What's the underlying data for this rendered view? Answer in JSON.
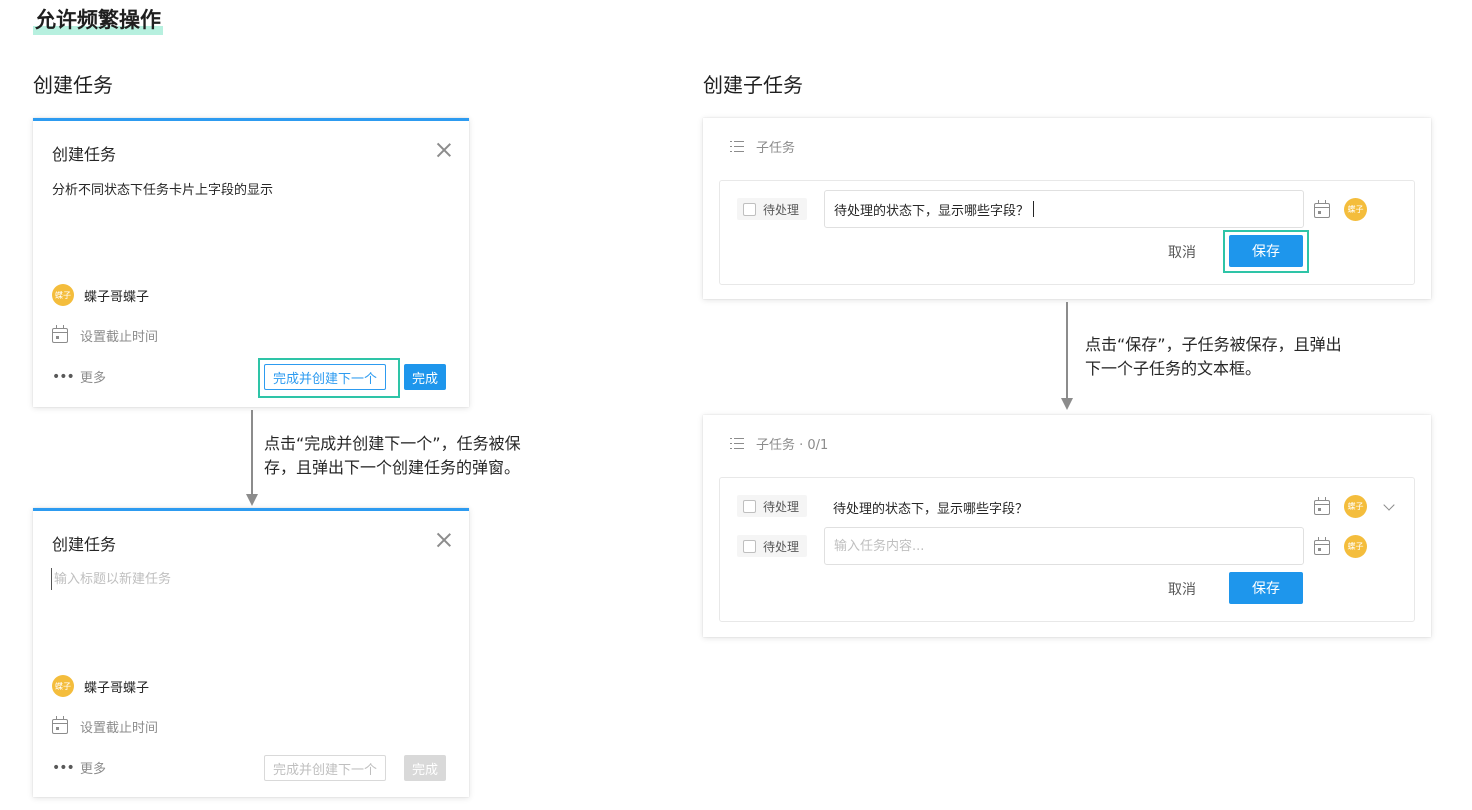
{
  "page_title": "允许频繁操作",
  "left_section": {
    "title": "创建任务",
    "dialog1": {
      "title": "创建任务",
      "content": "分析不同状态下任务卡片上字段的显示",
      "avatar_text": "蝶子",
      "assignee": "蝶子哥蝶子",
      "due_date": "设置截止时间",
      "more": "更多",
      "next_button": "完成并创建下一个",
      "done_button": "完成"
    },
    "annotation": "点击“完成并创建下一个”，任务被保存，且弹出下一个创建任务的弹窗。",
    "annotation_line1": "点击“完成并创建下一个”，任务被保",
    "annotation_line2": "存，且弹出下一个创建任务的弹窗。",
    "dialog2": {
      "title": "创建任务",
      "placeholder": "输入标题以新建任务",
      "avatar_text": "蝶子",
      "assignee": "蝶子哥蝶子",
      "due_date": "设置截止时间",
      "more": "更多",
      "next_button": "完成并创建下一个",
      "done_button": "完成"
    }
  },
  "right_section": {
    "title": "创建子任务",
    "panel1": {
      "header": "子任务",
      "status": "待处理",
      "input_value": "待处理的状态下，显示哪些字段？",
      "avatar_text": "蝶子",
      "cancel": "取消",
      "save": "保存"
    },
    "annotation_line1": "点击“保存”，子任务被保存，且弹出",
    "annotation_line2": "下一个子任务的文本框。",
    "panel2": {
      "header": "子任务 · 0/1",
      "row1_status": "待处理",
      "row1_text": "待处理的状态下，显示哪些字段？",
      "row2_status": "待处理",
      "row2_placeholder": "输入任务内容...",
      "avatar_text": "蝶子",
      "cancel": "取消",
      "save": "保存"
    }
  },
  "colors": {
    "accent": "#1e96ec",
    "highlight": "#2ec4a7",
    "avatar": "#f4bd3c"
  }
}
